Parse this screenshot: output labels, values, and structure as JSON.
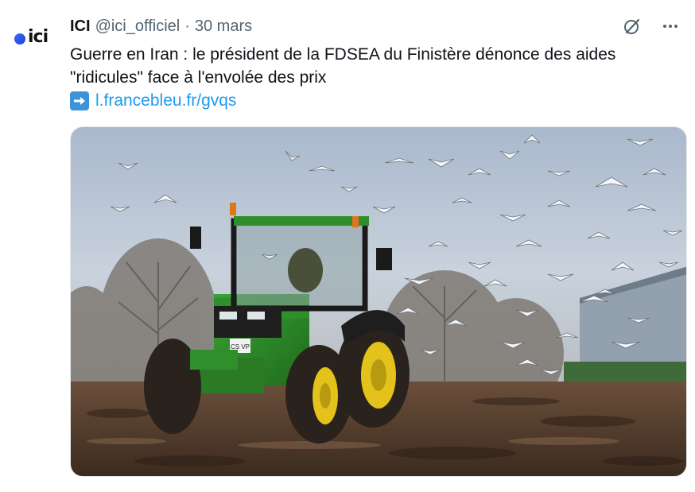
{
  "tweet": {
    "display_name": "ICI",
    "handle": "@ici_officiel",
    "separator": "·",
    "date": "30 mars",
    "avatar_logo_text": "ici",
    "text_line1": "Guerre en Iran : le président de la FDSEA du Finistère dénonce des aides",
    "text_line2": "\"ridicules\" face à l'envolée des prix",
    "link_text": "l.francebleu.fr/gvqs",
    "link_icon": "right-arrow-emoji",
    "more_icon": "more-dots-icon",
    "grok_icon": "grok-icon",
    "media": {
      "type": "photo",
      "plate_text": "CS VP"
    }
  },
  "colors": {
    "link": "#1d9bf0",
    "secondary_text": "#536471",
    "primary_text": "#0f1419",
    "tractor_green": "#2f8f2a",
    "wheel_yellow": "#e3c21b"
  }
}
